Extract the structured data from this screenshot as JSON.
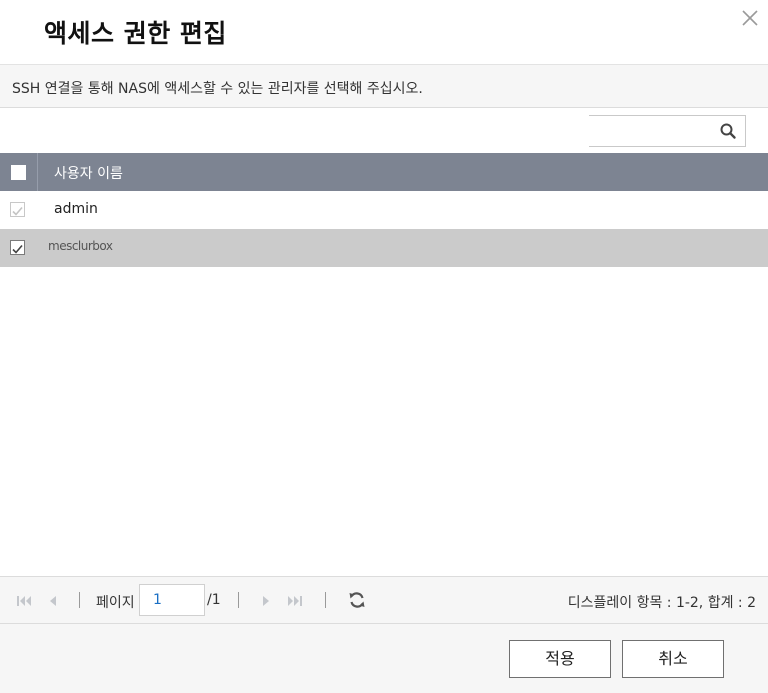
{
  "dialog": {
    "title": "액세스 권한 편집",
    "description": "SSH 연결을 통해 NAS에 액세스할 수 있는 관리자를 선택해 주십시오."
  },
  "search": {
    "value": "",
    "placeholder": ""
  },
  "table": {
    "header": {
      "username_label": "사용자 이름",
      "select_all_checked": false
    },
    "rows": [
      {
        "name": "admin",
        "checked": true,
        "disabled": true
      },
      {
        "name": "mesclurbox",
        "checked": true,
        "disabled": false
      }
    ]
  },
  "pager": {
    "page_label": "페이지",
    "current_page": "1",
    "total_pages": "/1",
    "display_info": "디스플레이 항목 :  1-2, 합계 :  2"
  },
  "buttons": {
    "apply": "적용",
    "cancel": "취소"
  },
  "colors": {
    "header_bg": "#7d8492",
    "selected_row_bg": "#cbcbcb",
    "panel_bg": "#f6f6f6",
    "page_input_text": "#1a6fc4"
  }
}
